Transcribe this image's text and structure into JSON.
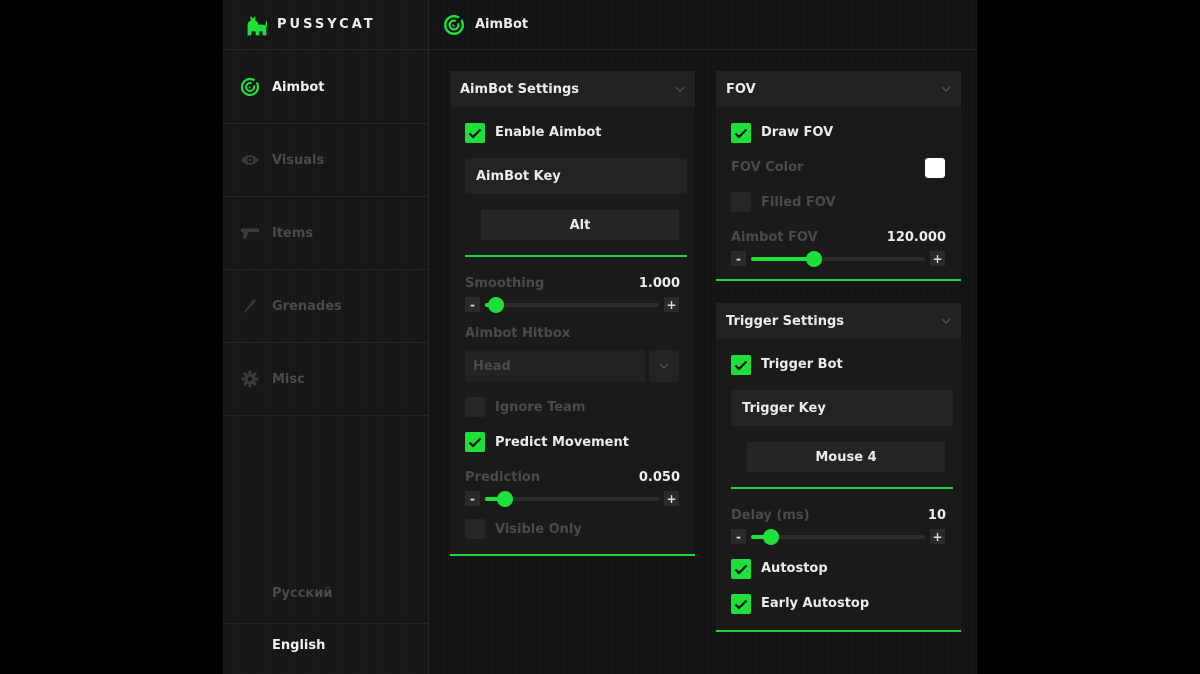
{
  "brand": {
    "name": "PUSSYCAT"
  },
  "header": {
    "title": "AimBot"
  },
  "sidebar": {
    "items": [
      {
        "label": "Aimbot",
        "icon": "target-icon",
        "active": true
      },
      {
        "label": "Visuals",
        "icon": "eye-icon",
        "active": false
      },
      {
        "label": "Items",
        "icon": "gun-icon",
        "active": false
      },
      {
        "label": "Grenades",
        "icon": "knife-icon",
        "active": false
      },
      {
        "label": "Misc",
        "icon": "gear-icon",
        "active": false
      }
    ],
    "languages": [
      {
        "label": "Русский",
        "active": false
      },
      {
        "label": "English",
        "active": true
      }
    ]
  },
  "aimbot_settings": {
    "title": "AimBot Settings",
    "enable_aimbot": {
      "label": "Enable Aimbot",
      "checked": true
    },
    "key_label": "AimBot Key",
    "key_value": "Alt",
    "smoothing": {
      "label": "Smoothing",
      "value": "1.000",
      "fraction": 0.03
    },
    "hitbox": {
      "label": "Aimbot Hitbox",
      "selected": "Head"
    },
    "ignore_team": {
      "label": "Ignore Team",
      "checked": false
    },
    "predict_movement": {
      "label": "Predict Movement",
      "checked": true
    },
    "prediction": {
      "label": "Prediction",
      "value": "0.050",
      "fraction": 0.08
    },
    "visible_only": {
      "label": "Visible Only",
      "checked": false
    }
  },
  "fov": {
    "title": "FOV",
    "draw_fov": {
      "label": "Draw FOV",
      "checked": true
    },
    "fov_color": {
      "label": "FOV Color",
      "color": "#ffffff"
    },
    "filled_fov": {
      "label": "Filled FOV",
      "checked": false
    },
    "aimbot_fov": {
      "label": "Aimbot FOV",
      "value": "120.000",
      "fraction": 0.33
    }
  },
  "trigger_settings": {
    "title": "Trigger Settings",
    "trigger_bot": {
      "label": "Trigger Bot",
      "checked": true
    },
    "key_label": "Trigger Key",
    "key_value": "Mouse 4",
    "delay": {
      "label": "Delay (ms)",
      "value": "10",
      "fraction": 0.08
    },
    "autostop": {
      "label": "Autostop",
      "checked": true
    },
    "early_autostop": {
      "label": "Early Autostop",
      "checked": true
    }
  },
  "colors": {
    "accent": "#1fe03a",
    "background": "#131313",
    "panel": "#1a1a1a"
  }
}
